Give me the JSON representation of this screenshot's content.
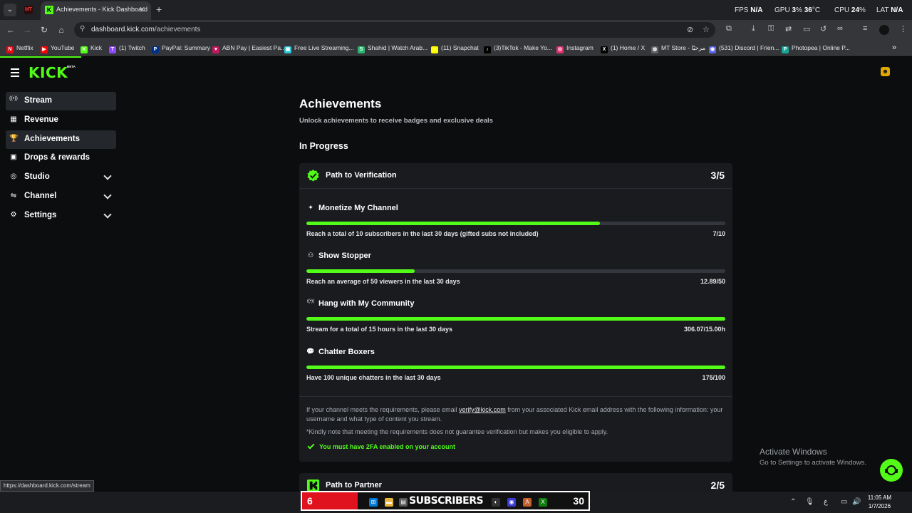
{
  "browser": {
    "active_tab_title": "Achievements - Kick Dashboard",
    "inactive_tab_icon": "MT",
    "new_tab_glyph": "+",
    "perf": {
      "fps_label": "FPS",
      "fps_value": "N/A",
      "gpu_label": "GPU",
      "gpu_value": "3",
      "gpu_unit": "%",
      "gpu_temp": "36",
      "gpu_temp_unit": "°C",
      "cpu_label": "CPU",
      "cpu_value": "24",
      "cpu_unit": "%",
      "lat_label": "LAT",
      "lat_value": "N/A"
    },
    "url_host": "dashboard.kick.com",
    "url_path": "/achievements",
    "bookmarks": [
      {
        "label": "Netflix",
        "icon": "netflix-icon",
        "color": "#e50914",
        "glyph": "N"
      },
      {
        "label": "YouTube",
        "icon": "youtube-icon",
        "color": "#ff0000",
        "glyph": "▶"
      },
      {
        "label": "Kick",
        "icon": "kick-icon",
        "color": "#53fc18",
        "glyph": "K"
      },
      {
        "label": "(1) Twitch",
        "icon": "twitch-icon",
        "color": "#9146ff",
        "glyph": "T"
      },
      {
        "label": "PayPal: Summary",
        "icon": "paypal-icon",
        "color": "#003087",
        "glyph": "P"
      },
      {
        "label": "ABN Pay | Easiest Pa...",
        "icon": "abn-pay-icon",
        "color": "#c2185b",
        "glyph": "♥"
      },
      {
        "label": "Free Live Streaming...",
        "icon": "streaming-icon",
        "color": "#26c6da",
        "glyph": "▣"
      },
      {
        "label": "Shahid | Watch Arab...",
        "icon": "shahid-icon",
        "color": "#2bb673",
        "glyph": "S"
      },
      {
        "label": "(11) Snapchat",
        "icon": "snapchat-icon",
        "color": "#fffc00",
        "glyph": "☺"
      },
      {
        "label": "(3)TikTok - Make Yo...",
        "icon": "tiktok-icon",
        "color": "#000000",
        "glyph": "♪"
      },
      {
        "label": "Instagram",
        "icon": "instagram-icon",
        "color": "#e1306c",
        "glyph": "◎"
      },
      {
        "label": "(1) Home / X",
        "icon": "x-icon",
        "color": "#000000",
        "glyph": "X"
      },
      {
        "label": "MT Store - مرحبًا",
        "icon": "globe-icon",
        "color": "#5f6368",
        "glyph": "◍"
      },
      {
        "label": "(531) Discord | Frien...",
        "icon": "discord-icon",
        "color": "#5865f2",
        "glyph": "◉"
      },
      {
        "label": "Photopea | Online P...",
        "icon": "photopea-icon",
        "color": "#18a497",
        "glyph": "P"
      }
    ],
    "bookmarks_overflow": "»",
    "status_url": "https://dashboard.kick.com/stream"
  },
  "app": {
    "logo_text": "KICK",
    "logo_badge": "BETA",
    "sidebar": [
      {
        "label": "Stream",
        "icon": "broadcast-icon",
        "glyph": "((•))",
        "selected": true,
        "expandable": false
      },
      {
        "label": "Revenue",
        "icon": "revenue-icon",
        "glyph": "▦",
        "selected": false,
        "expandable": false
      },
      {
        "label": "Achievements",
        "icon": "trophy-icon",
        "glyph": "🏆",
        "selected": true,
        "expandable": false
      },
      {
        "label": "Drops & rewards",
        "icon": "gift-icon",
        "glyph": "▣",
        "selected": false,
        "expandable": false
      },
      {
        "label": "Studio",
        "icon": "studio-icon",
        "glyph": "◎",
        "selected": false,
        "expandable": true
      },
      {
        "label": "Channel",
        "icon": "channel-icon",
        "glyph": "⇋",
        "selected": false,
        "expandable": true
      },
      {
        "label": "Settings",
        "icon": "gear-icon",
        "glyph": "⚙",
        "selected": false,
        "expandable": true
      }
    ],
    "page_title": "Achievements",
    "page_subtitle": "Unlock achievements to receive badges and exclusive deals",
    "section_heading": "In Progress",
    "verification_card": {
      "title": "Path to Verification",
      "count": "3/5",
      "achievements": [
        {
          "title": "Monetize My Channel",
          "icon": "sparkle-icon",
          "glyph": "✦",
          "description": "Reach a total of 10 subscribers in the last 30 days (gifted subs not included)",
          "progress_text": "7/10",
          "progress": 0.7
        },
        {
          "title": "Show Stopper",
          "icon": "viewers-icon",
          "glyph": "⚇",
          "description": "Reach an average of 50 viewers in the last 30 days",
          "progress_text": "12.89/50",
          "progress": 0.258
        },
        {
          "title": "Hang with My Community",
          "icon": "broadcast-icon",
          "glyph": "((•))",
          "description": "Stream for a total of 15 hours in the last 30 days",
          "progress_text": "306.07/15.00h",
          "progress": 1.0
        },
        {
          "title": "Chatter Boxers",
          "icon": "chat-icon",
          "glyph": "💬",
          "description": "Have 100 unique chatters in the last 30 days",
          "progress_text": "175/100",
          "progress": 1.0
        }
      ],
      "info_before_link": "If your channel meets the requirements, please email ",
      "info_link": "verify@kick.com",
      "info_after_link": " from your associated Kick email address with the following information: your username and what type of content you stream.",
      "note": "*Kindly note that meeting the requirements does not guarantee verification but makes you eligible to apply.",
      "requirement": "You must have 2FA enabled on your account"
    },
    "partner_card": {
      "title": "Path to Partner",
      "count": "2/5"
    },
    "activate_title": "Activate Windows",
    "activate_subtitle": "Go to Settings to activate Windows."
  },
  "taskbar": {
    "widget_number": "6",
    "widget_label": "SUBSCRIBERS",
    "widget_count": "30",
    "clock_time": "11:05 AM",
    "clock_date": "1/7/2026",
    "tray_lang": "ع"
  },
  "colors": {
    "accent": "#53fc18",
    "background": "#0b0d0e",
    "card": "#191b1f",
    "widget_red": "#e0121d"
  }
}
